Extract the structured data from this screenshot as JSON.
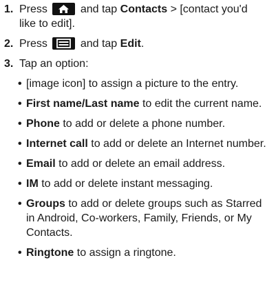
{
  "steps": [
    {
      "number": "1.",
      "parts": {
        "a": "Press",
        "icon": "home-icon",
        "b": "and tap",
        "bold1": "Contacts",
        "c": ">",
        "d": "[contact you'd",
        "e": "like to edit]."
      }
    },
    {
      "number": "2.",
      "parts": {
        "a": "Press",
        "icon": "menu-icon",
        "b": "and tap",
        "bold1": "Edit",
        "c": "."
      }
    },
    {
      "number": "3.",
      "parts": {
        "a": "Tap an option:"
      }
    }
  ],
  "options": [
    {
      "bold": "",
      "text": "[image icon] to assign a picture to the entry."
    },
    {
      "bold": "First name/Last name",
      "text": " to edit the current name."
    },
    {
      "bold": "Phone",
      "text": " to add or delete a phone number."
    },
    {
      "bold": "Internet call",
      "text": " to add or delete an Internet number."
    },
    {
      "bold": "Email",
      "text": " to add or delete an email address."
    },
    {
      "bold": "IM",
      "text": " to add or delete instant messaging."
    },
    {
      "bold": "Groups",
      "text": " to add or delete groups such as Starred in Android, Co-workers, Family, Friends, or My Contacts."
    },
    {
      "bold": "Ringtone",
      "text": " to assign a ringtone."
    }
  ]
}
